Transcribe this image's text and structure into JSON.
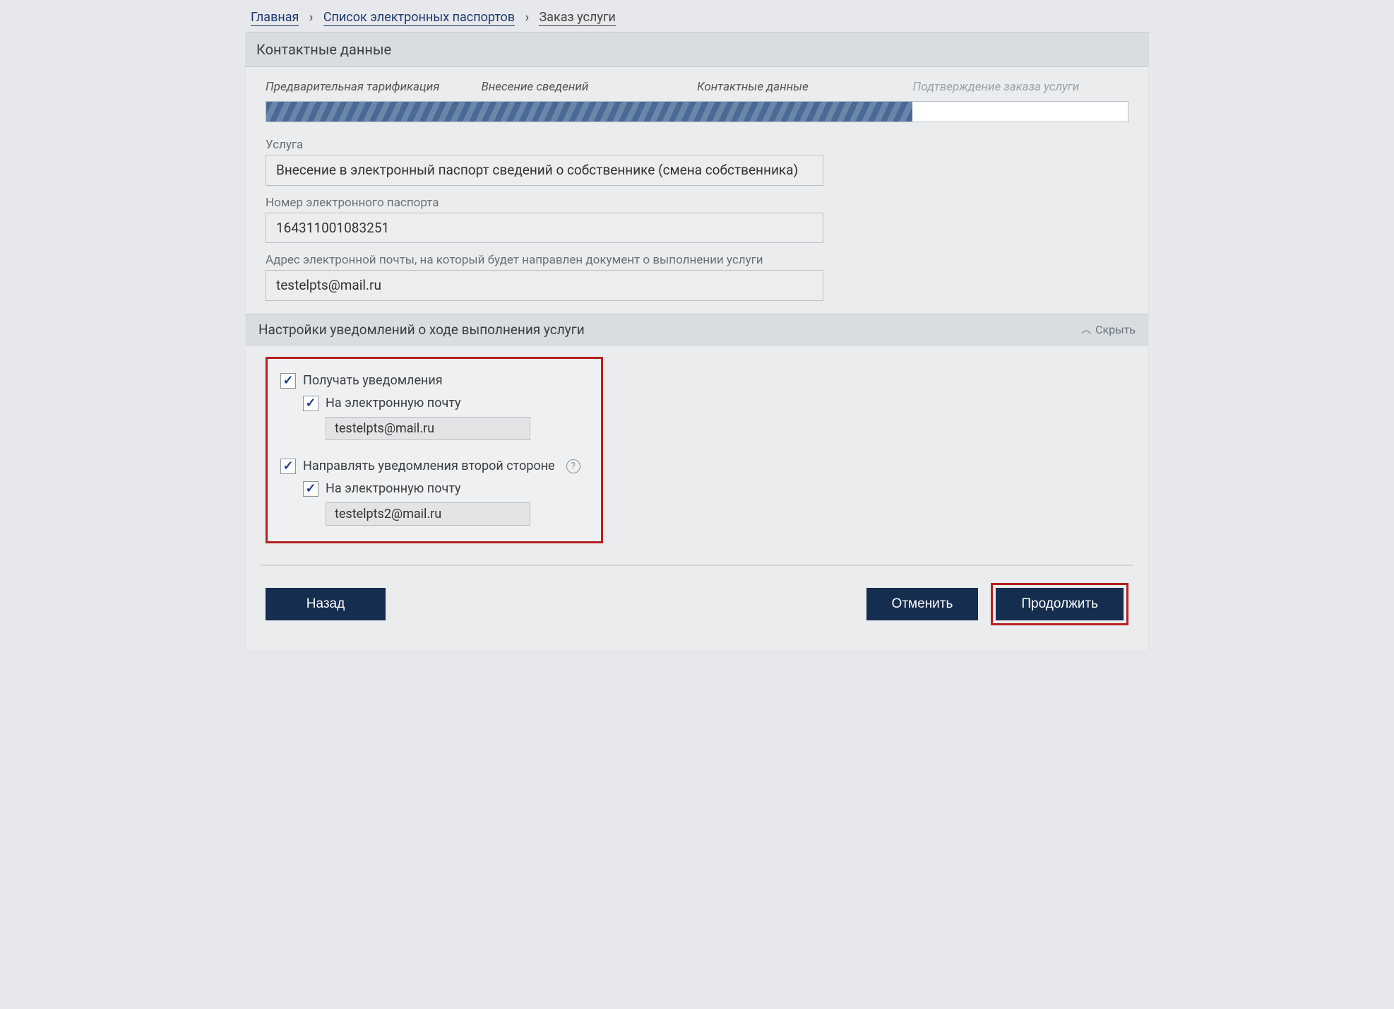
{
  "breadcrumb": {
    "home": "Главная",
    "list": "Список электронных паспортов",
    "current": "Заказ услуги"
  },
  "panel_title": "Контактные данные",
  "steps": {
    "s1": "Предварительная тарификация",
    "s2": "Внесение сведений",
    "s3": "Контактные данные",
    "s4": "Подтверждение заказа услуги"
  },
  "progress_percent": 75,
  "fields": {
    "service": {
      "label": "Услуга",
      "value": "Внесение в электронный паспорт сведений о собственнике (смена собственника)"
    },
    "passport": {
      "label": "Номер электронного паспорта",
      "value": "164311001083251"
    },
    "email": {
      "label": "Адрес электронной почты, на который будет направлен документ о выполнении услуги",
      "value": "testelpts@mail.ru"
    }
  },
  "notif": {
    "header": "Настройки уведомлений о ходе выполнения услуги",
    "toggle": "Скрыть",
    "receive": "Получать уведомления",
    "by_email": "На электронную почту",
    "own_email": "testelpts@mail.ru",
    "send_other": "Направлять уведомления второй стороне",
    "other_email": "testelpts2@mail.ru"
  },
  "actions": {
    "back": "Назад",
    "cancel": "Отменить",
    "continue": "Продолжить"
  }
}
